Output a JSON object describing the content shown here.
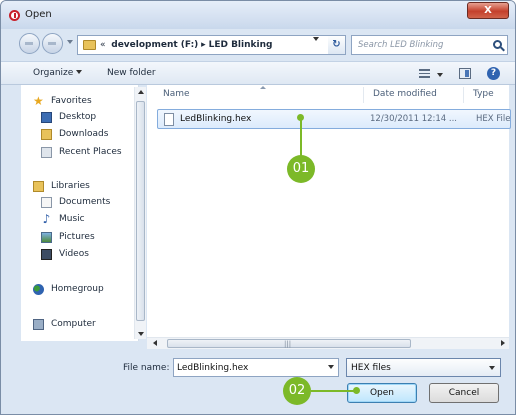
{
  "window": {
    "title": "Open",
    "close_label": "X"
  },
  "address": {
    "crumb_prefix": "«",
    "crumbs": [
      "development (F:)",
      "LED Blinking"
    ],
    "separator": "▸",
    "search_placeholder": "Search LED Blinking",
    "refresh_symbol": "↻"
  },
  "toolbar": {
    "organize": "Organize",
    "new_folder": "New folder",
    "help": "?"
  },
  "nav": {
    "favorites": "Favorites",
    "desktop": "Desktop",
    "downloads": "Downloads",
    "recent": "Recent Places",
    "libraries": "Libraries",
    "documents": "Documents",
    "music": "Music",
    "pictures": "Pictures",
    "videos": "Videos",
    "homegroup": "Homegroup",
    "computer": "Computer"
  },
  "columns": {
    "name": "Name",
    "date": "Date modified",
    "type": "Type"
  },
  "files": [
    {
      "name": "LedBlinking.hex",
      "date": "12/30/2011 12:14 ...",
      "type": "HEX File"
    }
  ],
  "bottom": {
    "file_name_label": "File name:",
    "file_name_value": "LedBlinking.hex",
    "file_type": "HEX files",
    "open": "Open",
    "cancel": "Cancel"
  },
  "callouts": {
    "one": "01",
    "two": "02"
  },
  "colors": {
    "callout": "#7cb928",
    "close": "#c4402c",
    "accent": "#3c7fb1"
  }
}
